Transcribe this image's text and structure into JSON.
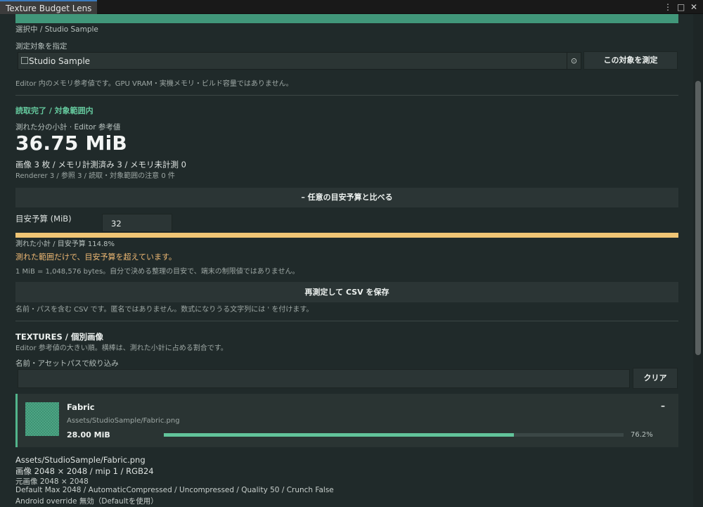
{
  "window": {
    "tab_title": "Texture Budget Lens"
  },
  "selection": {
    "current_label": "選択中  /  Studio Sample"
  },
  "target": {
    "label": "測定対象を指定",
    "value": "Studio Sample",
    "measure_button": "この対象を測定",
    "note": "Editor 内のメモリ参考値です。GPU VRAM・実機メモリ・ビルド容量ではありません。"
  },
  "summary": {
    "status": "読取完了  /  対象範囲内",
    "subtotal_label": "測れた分の小計  ·  Editor 参考値",
    "total": "36.75 MiB",
    "counts": "画像 3 枚    /    メモリ計測済み 3    /    メモリ未計測 0",
    "refs": "Renderer 3    /    参照 3    /    読取・対象範囲の注意 0 件"
  },
  "budget": {
    "toggle_label": "–  任意の目安予算と比べる",
    "label": "目安予算 (MiB)",
    "value": "32",
    "progress_fraction": 1.0,
    "ratio_text": "測れた小計 / 目安予算  114.8%",
    "warning": "測れた範囲だけで、目安予算を超えています。",
    "mib_note": "1 MiB = 1,048,576 bytes。自分で決める整理の目安で、端末の制限値ではありません。",
    "color_warn": "#f0c575"
  },
  "csv": {
    "button": "再測定して CSV を保存",
    "note": "名前・パスを含む CSV です。匿名ではありません。数式になりうる文字列には ' を付けます。"
  },
  "textures": {
    "heading": "TEXTURES  /  個別画像",
    "description": "Editor 参考値の大きい順。横棒は、測れた小計に占める割合です。",
    "filter_label": "名前・アセットパスで絞り込み",
    "filter_value": "",
    "clear_button": "クリア",
    "items": [
      {
        "name": "Fabric",
        "path": "Assets/StudioSample/Fabric.png",
        "size": "28.00 MiB",
        "share_fraction": 0.762,
        "share_text": "76.2%",
        "collapse_symbol": "–"
      }
    ]
  },
  "detail": {
    "path": "Assets/StudioSample/Fabric.png",
    "image": "画像  2048 × 2048  /  mip 1  /  RGB24",
    "original": "元画像  2048 × 2048",
    "default": "Default  Max 2048 / AutomaticCompressed / Uncompressed / Quality 50 / Crunch False",
    "android": "Android override  無効（Defaultを使用）"
  },
  "colors": {
    "accent": "#41977a",
    "progress": "#62c49b",
    "warning_text": "#efb974"
  }
}
